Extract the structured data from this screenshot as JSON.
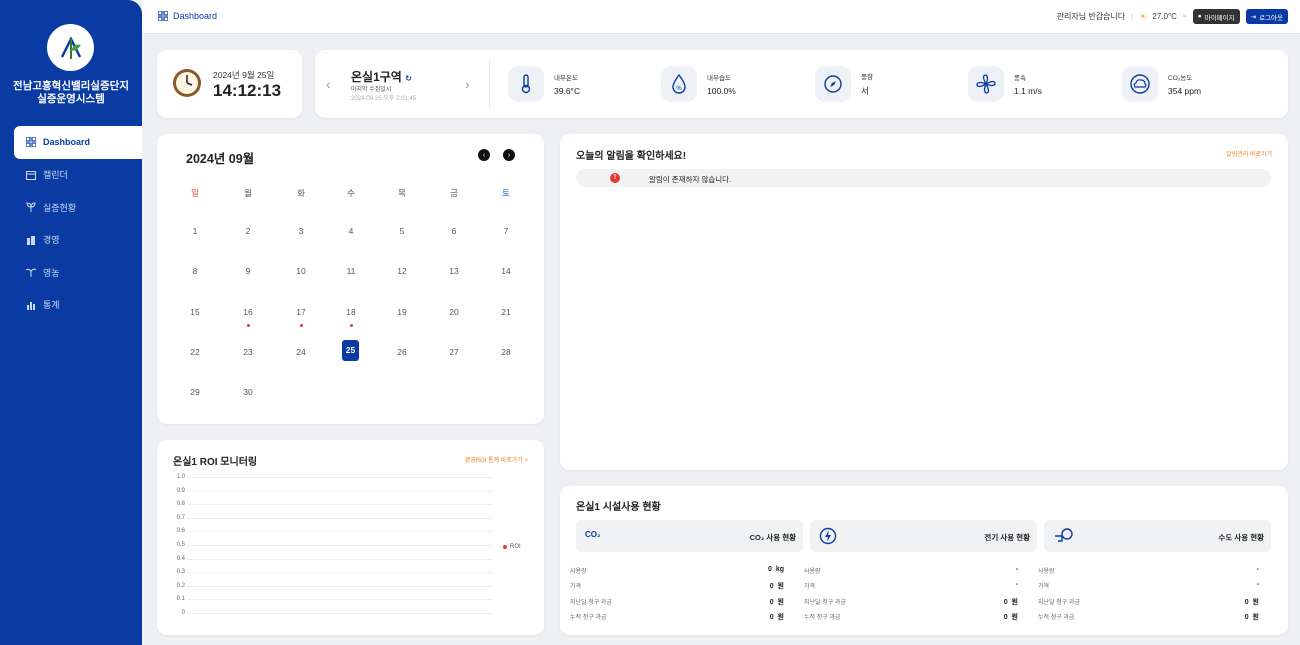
{
  "sidebar": {
    "system_name_line1": "전남고흥혁신밸리실증단지",
    "system_name_line2": "실증운영시스템",
    "items": [
      {
        "label": "Dashboard",
        "icon": "grid-icon"
      },
      {
        "label": "캘린더",
        "icon": "calendar-icon"
      },
      {
        "label": "실증현황",
        "icon": "sprout-icon"
      },
      {
        "label": "경영",
        "icon": "building-icon"
      },
      {
        "label": "영농",
        "icon": "plant-icon"
      },
      {
        "label": "통계",
        "icon": "bar-chart-icon"
      }
    ]
  },
  "topbar": {
    "breadcrumb": "Dashboard",
    "greeting": "관리자님 반갑습니다",
    "weather_temp": "27.0°C",
    "mypage_label": "마이페이지",
    "logout_label": "로그아웃"
  },
  "clock": {
    "date": "2024년 9월 25일",
    "time": "14:12:13"
  },
  "environment": {
    "zone": "온실1구역",
    "last_collected_label": "마지막 수집일시",
    "last_collected_time": "2024-09-25 오후 2:01:45",
    "sensors": [
      {
        "label": "내부온도",
        "value": "39.6°C",
        "icon": "thermometer-icon"
      },
      {
        "label": "내부습도",
        "value": "100.0%",
        "icon": "humidity-icon"
      },
      {
        "label": "풍향",
        "value": "서",
        "icon": "compass-icon"
      },
      {
        "label": "풍속",
        "value": "1.1 m/s",
        "icon": "fan-icon"
      },
      {
        "label": "CO₂농도",
        "value": "354 ppm",
        "icon": "cloud-icon"
      }
    ]
  },
  "calendar": {
    "title": "2024년 09월",
    "weekdays": [
      "일",
      "월",
      "화",
      "수",
      "목",
      "금",
      "토"
    ],
    "weeks": [
      [
        "1",
        "2",
        "3",
        "4",
        "5",
        "6",
        "7"
      ],
      [
        "8",
        "9",
        "10",
        "11",
        "12",
        "13",
        "14"
      ],
      [
        "15",
        "16",
        "17",
        "18",
        "19",
        "20",
        "21"
      ],
      [
        "22",
        "23",
        "24",
        "25",
        "26",
        "27",
        "28"
      ],
      [
        "29",
        "30",
        "",
        "",
        "",
        "",
        ""
      ]
    ],
    "today": "25",
    "event_days": [
      "16",
      "17",
      "18"
    ]
  },
  "roi": {
    "title": "온실1 ROI 모니터링",
    "link": "경영ROI 통계 바로가기 >",
    "legend": "ROI",
    "y_ticks": [
      "1.0",
      "0.9",
      "0.8",
      "0.7",
      "0.6",
      "0.5",
      "0.4",
      "0.3",
      "0.2",
      "0.1",
      "0"
    ]
  },
  "alerts": {
    "title": "오늘의 알림을 확인하세요!",
    "link": "알림관리 바로가기",
    "empty_icon_text": "!",
    "empty_message": "알림이 존재하지 않습니다."
  },
  "usage": {
    "title": "온실1 시설사용 현황",
    "sections": [
      {
        "header": "CO₂ 사용 현황",
        "icon_text": "CO₂",
        "rows": [
          {
            "label": "사용량",
            "value": "0  kg"
          },
          {
            "label": "가격",
            "value": "0  원"
          },
          {
            "label": "지난달 청구 과금",
            "value": "0  원"
          },
          {
            "label": "누적 청구 과금",
            "value": "0  원"
          }
        ]
      },
      {
        "header": "전기 사용 현황",
        "rows": [
          {
            "label": "사용량",
            "value": "-"
          },
          {
            "label": "가격",
            "value": "-"
          },
          {
            "label": "지난달 청구 과금",
            "value": "0  원"
          },
          {
            "label": "누적 청구 과금",
            "value": "0  원"
          }
        ]
      },
      {
        "header": "수도 사용 현황",
        "rows": [
          {
            "label": "사용량",
            "value": "-"
          },
          {
            "label": "가격",
            "value": "-"
          },
          {
            "label": "지난달 청구 과금",
            "value": "0  원"
          },
          {
            "label": "누적 청구 과금",
            "value": "0  원"
          }
        ]
      }
    ]
  }
}
